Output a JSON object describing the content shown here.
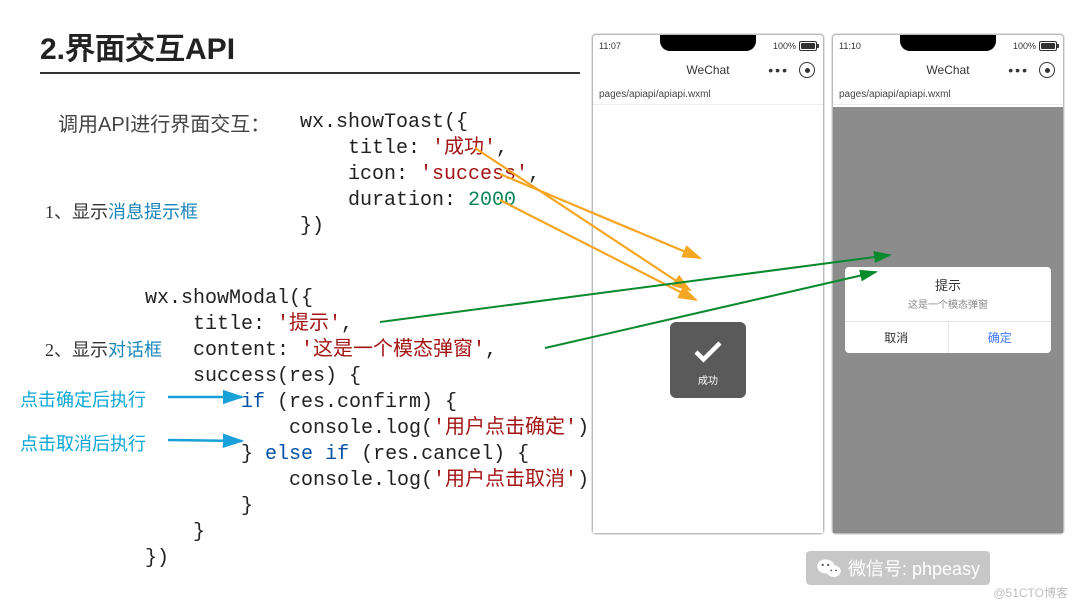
{
  "section_title": "2.界面交互API",
  "subtitle": "调用API进行界面交互：",
  "list": {
    "item1_prefix": "1、显示",
    "item1_kw": "消息提示框",
    "item2_prefix": "2、显示",
    "item2_kw": "对话框"
  },
  "callouts": {
    "confirm": "点击确定后执行",
    "cancel": "点击取消后执行"
  },
  "code": {
    "toast": {
      "fn": "wx.showToast({",
      "l1a": "    title: ",
      "l1s": "'成功'",
      "l1b": ",",
      "l2a": "    icon: ",
      "l2s": "'success'",
      "l2b": ",",
      "l3a": "    duration: ",
      "l3n": "2000",
      "end": "})"
    },
    "modal": {
      "fn": "wx.showModal({",
      "l1a": "    title: ",
      "l1s": "'提示'",
      "l1b": ",",
      "l2a": "    content: ",
      "l2s": "'这是一个模态弹窗'",
      "l2b": ",",
      "l3": "    success(res) {",
      "l4a": "        ",
      "l4k": "if",
      "l4b": " (res.confirm) {",
      "l5a": "            console.log(",
      "l5s": "'用户点击确定'",
      "l5b": ")",
      "l6a": "        } ",
      "l6k1": "else",
      "l6b": " ",
      "l6k2": "if",
      "l6c": " (res.cancel) {",
      "l7a": "            console.log(",
      "l7s": "'用户点击取消'",
      "l7b": ")",
      "l8": "        }",
      "l9": "    }",
      "end": "})"
    }
  },
  "phone1": {
    "time": "11:07",
    "batt": "100%",
    "title": "WeChat",
    "path": "pages/apiapi/apiapi.wxml",
    "toast_label": "成功"
  },
  "phone2": {
    "time": "11:10",
    "batt": "100%",
    "title": "WeChat",
    "path": "pages/apiapi/apiapi.wxml",
    "modal_title": "提示",
    "modal_content": "这是一个模态弹窗",
    "btn_cancel": "取消",
    "btn_ok": "确定"
  },
  "footer": {
    "wechat_label": "微信号: phpeasy",
    "attrib": "@51CTO博客"
  }
}
